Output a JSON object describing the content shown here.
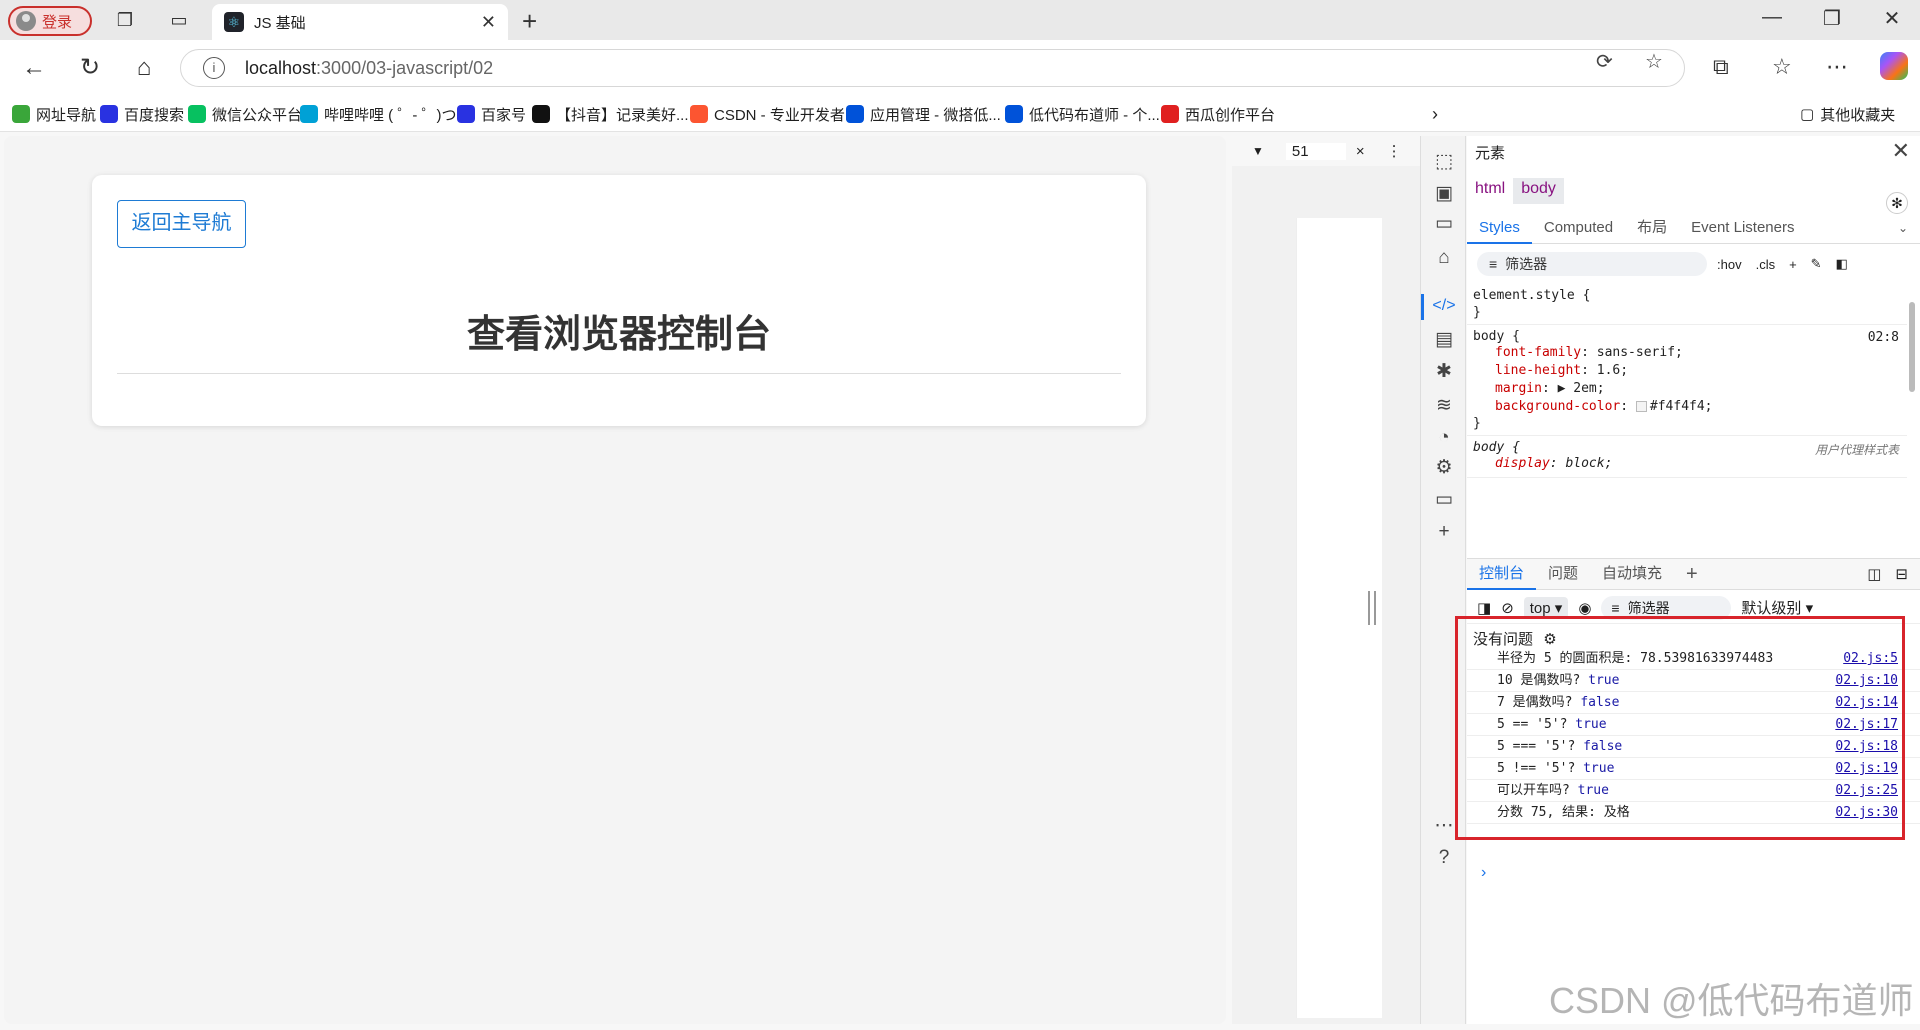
{
  "browser": {
    "login_label": "登录",
    "tab_title": "JS 基础",
    "url_host": "localhost",
    "url_rest": ":3000/03-javascript/02",
    "bookmarks": [
      {
        "label": "网址导航",
        "color": "#3aa63a"
      },
      {
        "label": "百度搜索",
        "color": "#2932e1"
      },
      {
        "label": "微信公众平台",
        "color": "#07c160"
      },
      {
        "label": "哔哩哔哩 ( ゜- ゜)つ...",
        "color": "#00a1d6"
      },
      {
        "label": "百家号",
        "color": "#2932e1"
      },
      {
        "label": "【抖音】记录美好...",
        "color": "#111111"
      },
      {
        "label": "CSDN - 专业开发者...",
        "color": "#fc5531"
      },
      {
        "label": "应用管理 - 微搭低...",
        "color": "#0052d9"
      },
      {
        "label": "低代码布道师 - 个...",
        "color": "#0052d9"
      },
      {
        "label": "西瓜创作平台",
        "color": "#e02020"
      }
    ],
    "other_bookmarks": "其他收藏夹"
  },
  "page": {
    "back_button": "返回主导航",
    "title": "查看浏览器控制台"
  },
  "device_toolbar": {
    "width_value": "51"
  },
  "devtools": {
    "panel_title": "元素",
    "breadcrumbs": [
      "html",
      "body"
    ],
    "subtabs": [
      "Styles",
      "Computed",
      "布局",
      "Event Listeners"
    ],
    "filter_placeholder": "筛选器",
    "hov": ":hov",
    "cls": ".cls",
    "styles": {
      "element_style": "element.style {",
      "close_brace": "}",
      "body_selector": "body {",
      "body_source": "02:8",
      "props": [
        {
          "name": "font-family",
          "value": "sans-serif;"
        },
        {
          "name": "line-height",
          "value": "1.6;"
        },
        {
          "name": "margin",
          "value": "▶ 2em;"
        },
        {
          "name": "background-color",
          "value": "#f4f4f4;"
        }
      ],
      "ua_selector": "body {",
      "ua_source": "用户代理样式表",
      "ua_prop_name": "display",
      "ua_prop_value": "block;"
    },
    "drawer_tabs": [
      "控制台",
      "问题",
      "自动填充"
    ],
    "context": "top",
    "console_filter": "筛选器",
    "level": "默认级别",
    "no_issues": "没有问题",
    "logs": [
      {
        "text": "半径为 5 的圆面积是: 78.53981633974483",
        "bool": "",
        "src": "02.js:5"
      },
      {
        "text": "10 是偶数吗? ",
        "bool": "true",
        "src": "02.js:10"
      },
      {
        "text": "7 是偶数吗? ",
        "bool": "false",
        "src": "02.js:14"
      },
      {
        "text": "5 == '5'? ",
        "bool": "true",
        "src": "02.js:17"
      },
      {
        "text": "5 === '5'? ",
        "bool": "false",
        "src": "02.js:18"
      },
      {
        "text": "5 !== '5'? ",
        "bool": "true",
        "src": "02.js:19"
      },
      {
        "text": "可以开车吗? ",
        "bool": "true",
        "src": "02.js:25"
      },
      {
        "text": "分数 75, 结果: 及格",
        "bool": "",
        "src": "02.js:30"
      }
    ],
    "prompt": "›"
  },
  "watermark": "CSDN @低代码布道师"
}
